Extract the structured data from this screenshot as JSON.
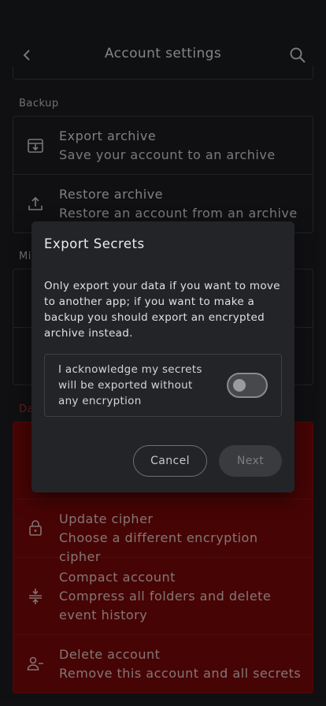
{
  "appbar": {
    "title": "Account settings",
    "back_icon": "chevron-left-icon",
    "search_icon": "search-icon"
  },
  "sections": {
    "backup": {
      "label": "Backup",
      "items": [
        {
          "icon": "download-box-icon",
          "title": "Export archive",
          "subtitle": "Save your account to an archive"
        },
        {
          "icon": "upload-icon",
          "title": "Restore archive",
          "subtitle": "Restore an account from an archive"
        }
      ]
    },
    "misc": {
      "label_visible": "Mi"
    },
    "danger": {
      "label_visible": "Da",
      "items": [
        {
          "icon": "lock-icon",
          "title": "Update cipher",
          "subtitle": "Choose a different encryption cipher"
        },
        {
          "icon": "compress-icon",
          "title": "Compact account",
          "subtitle": "Compress all folders and delete event history"
        },
        {
          "icon": "person-remove-icon",
          "title": "Delete account",
          "subtitle": "Remove this account and all secrets"
        }
      ]
    }
  },
  "dialog": {
    "title": "Export Secrets",
    "body": "Only export your data if you want to move to another app; if you want to make a backup you should export an encrypted archive instead.",
    "acknowledge": "I acknowledge my secrets will be exported without any encryption",
    "toggle_on": false,
    "cancel_label": "Cancel",
    "next_label": "Next"
  },
  "colors": {
    "background": "#1c1d1f",
    "danger": "#7a0707",
    "dialog": "#232428"
  }
}
